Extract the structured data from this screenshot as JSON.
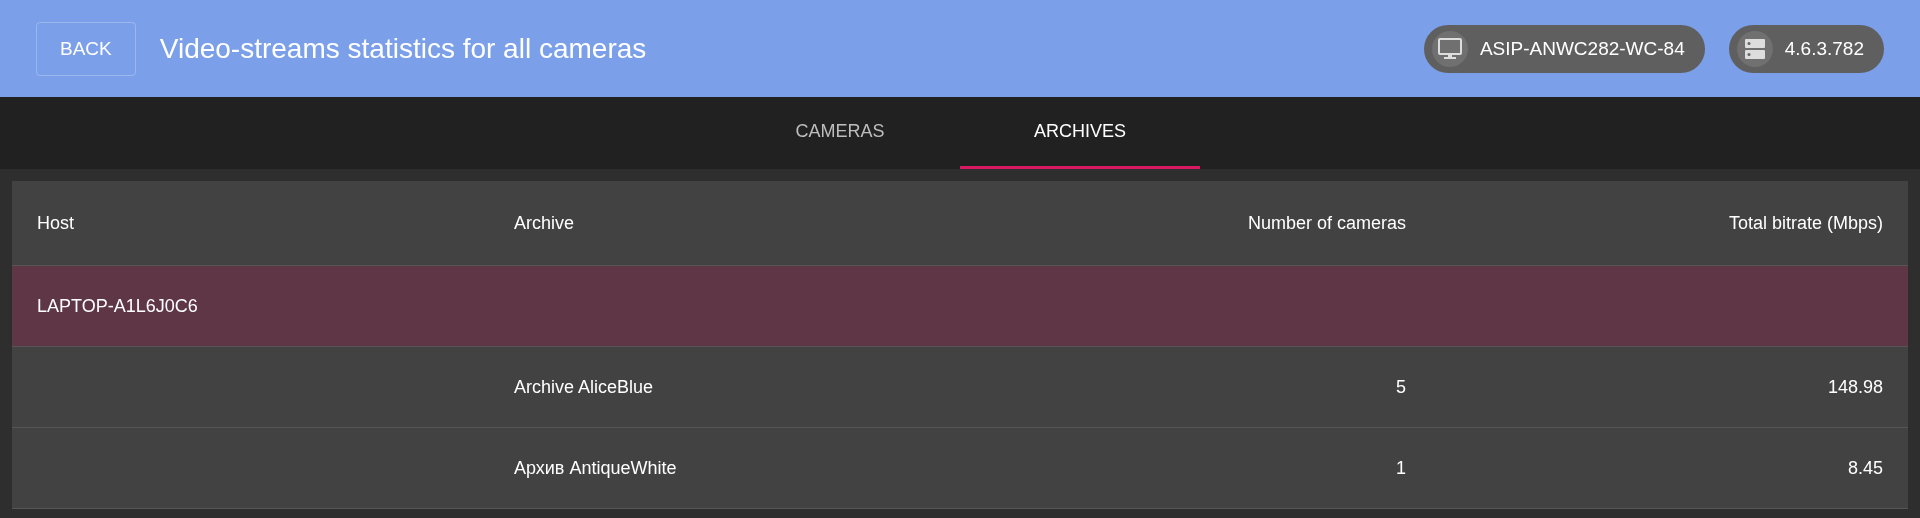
{
  "header": {
    "back_button": "BACK",
    "title": "Video-streams statistics for all cameras",
    "chips": [
      {
        "kind": "computer",
        "label": "ASIP-ANWC282-WC-84"
      },
      {
        "kind": "server",
        "label": "4.6.3.782"
      }
    ]
  },
  "tabs": [
    {
      "label": "CAMERAS",
      "selected": false
    },
    {
      "label": "ARCHIVES",
      "selected": true
    }
  ],
  "table": {
    "columns": [
      "Host",
      "Archive",
      "Number of cameras",
      "Total bitrate (Mbps)"
    ],
    "rows": [
      {
        "kind": "group",
        "host": "LAPTOP-A1L6J0C6"
      },
      {
        "kind": "archive",
        "archive": "Archive AliceBlue",
        "cameras": "5",
        "bitrate": "148.98"
      },
      {
        "kind": "archive",
        "archive": "Архив AntiqueWhite",
        "cameras": "1",
        "bitrate": "8.45"
      }
    ]
  }
}
